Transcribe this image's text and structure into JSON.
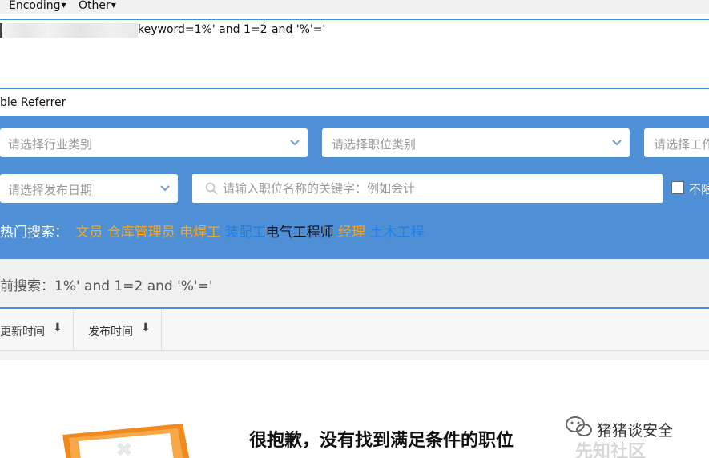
{
  "menu": {
    "encoding": "Encoding",
    "other": "Other"
  },
  "url": {
    "visible_text": "keyword=1%' and 1=2",
    "after_caret": " and '%'='"
  },
  "referrer": {
    "label": "ble Referrer"
  },
  "filters": {
    "industry_placeholder": "请选择行业类别",
    "position_placeholder": "请选择职位类别",
    "third_placeholder": "请选择工作",
    "date_placeholder": "请选择发布日期",
    "search_placeholder": "请输入职位名称的关键字：例如会计",
    "checkbox_label": "不限"
  },
  "hot_search": {
    "label": "热门搜索：",
    "keywords": [
      {
        "text": "文员",
        "color": "#f6a623"
      },
      {
        "text": "仓库管理员",
        "color": "#f6a623"
      },
      {
        "text": "电焊工",
        "color": "#f6a623"
      },
      {
        "text": "装配工",
        "color": "#1e7fe6"
      },
      {
        "text": "电气工程师",
        "color": "#111111"
      },
      {
        "text": "经理",
        "color": "#f6a623"
      },
      {
        "text": "土木工程",
        "color": "#1e7fe6"
      }
    ]
  },
  "current_search": {
    "text": "前搜索：1%' and 1=2 and '%'='"
  },
  "sort": {
    "updated": "更新时间",
    "published": "发布时间",
    "arrow": "⬇"
  },
  "empty_state": {
    "message": "很抱歉，没有找到满足条件的职位"
  },
  "watermark": {
    "account": "猪猪谈安全",
    "site": "先知社区"
  },
  "colors": {
    "panel_blue": "#4e8fd6",
    "accent_orange": "#f6a623",
    "link_blue": "#1e7fe6"
  }
}
